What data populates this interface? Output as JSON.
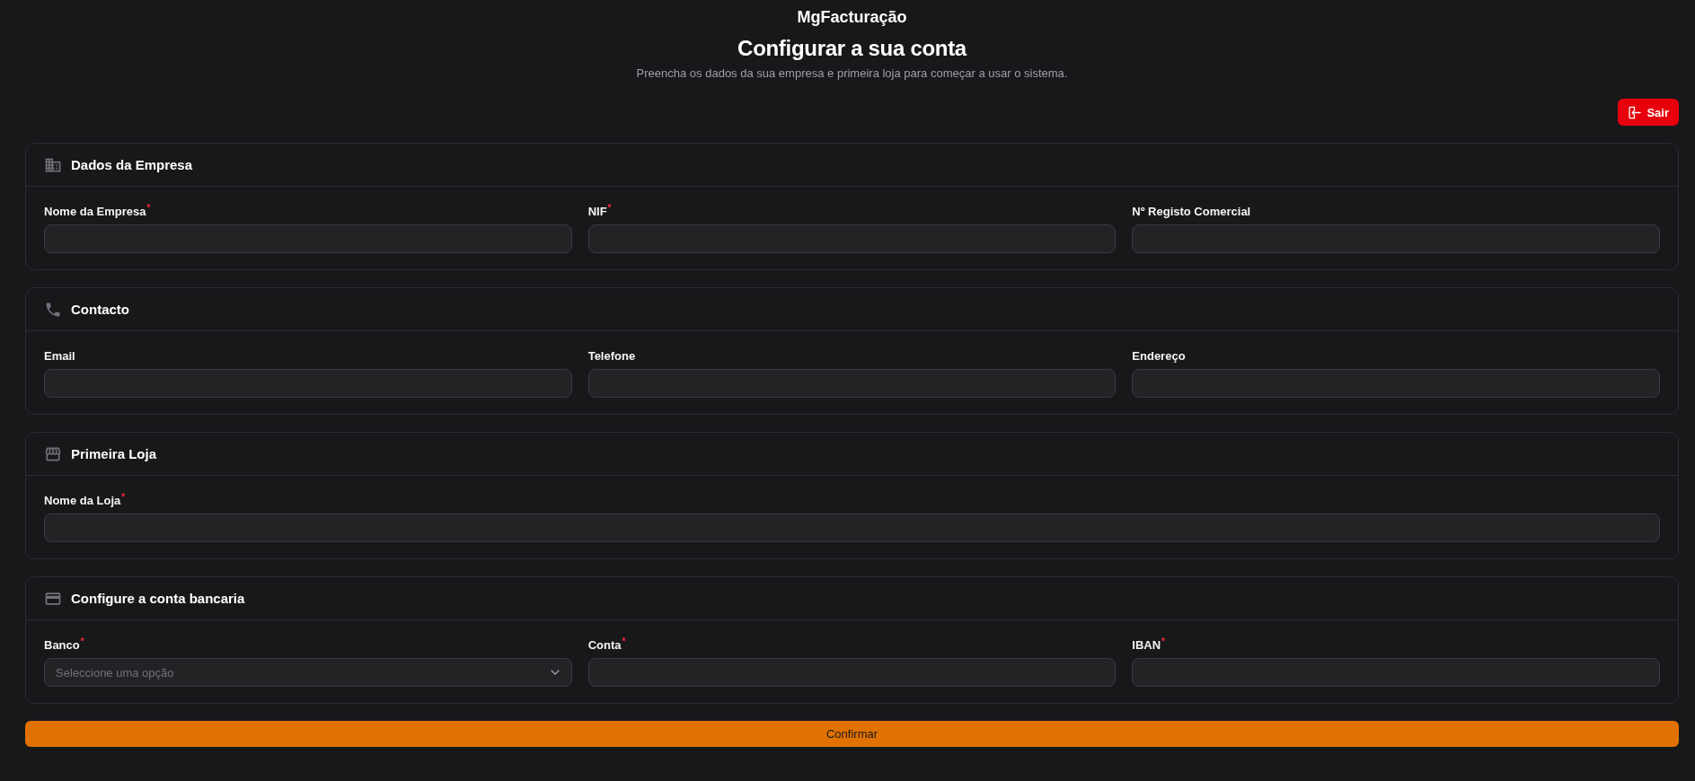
{
  "app": {
    "name": "MgFacturação"
  },
  "page": {
    "title": "Configurar a sua conta",
    "subtitle": "Preencha os dados da sua empresa e primeira loja para começar a usar o sistema."
  },
  "logout_button": {
    "label": "Sair"
  },
  "sections": [
    {
      "kind": "company",
      "title": "Dados da Empresa",
      "fields": [
        {
          "kind": "text",
          "label": "Nome da Empresa$^{*}$"
        },
        {
          "kind": "text",
          "label": "NIF$^{*}$"
        },
        {
          "kind": "text",
          "label": "Nº Registo Comercial"
        }
      ]
    },
    {
      "kind": "contact",
      "title": "Contacto",
      "fields": [
        {
          "kind": "text",
          "label": "Email"
        },
        {
          "kind": "text",
          "label": "Telefone"
        },
        {
          "kind": "text",
          "label": "Endereço"
        }
      ]
    },
    {
      "kind": "store",
      "title": "Primeira Loja",
      "fields": [
        {
          "kind": "text",
          "label": "Nome da Loja$^{*}$"
        }
      ]
    },
    {
      "kind": "bank",
      "title": "Configure a conta bancaria",
      "fields": [
        {
          "kind": "select",
          "label": "Banco$^{*}$",
          "placeholder": "Seleccione uma opção"
        },
        {
          "kind": "text",
          "label": "Conta$^{*}$"
        },
        {
          "kind": "text",
          "label": "IBAN$^{*}$"
        }
      ]
    }
  ],
  "confirm_button": {
    "label": "Confirmar"
  }
}
